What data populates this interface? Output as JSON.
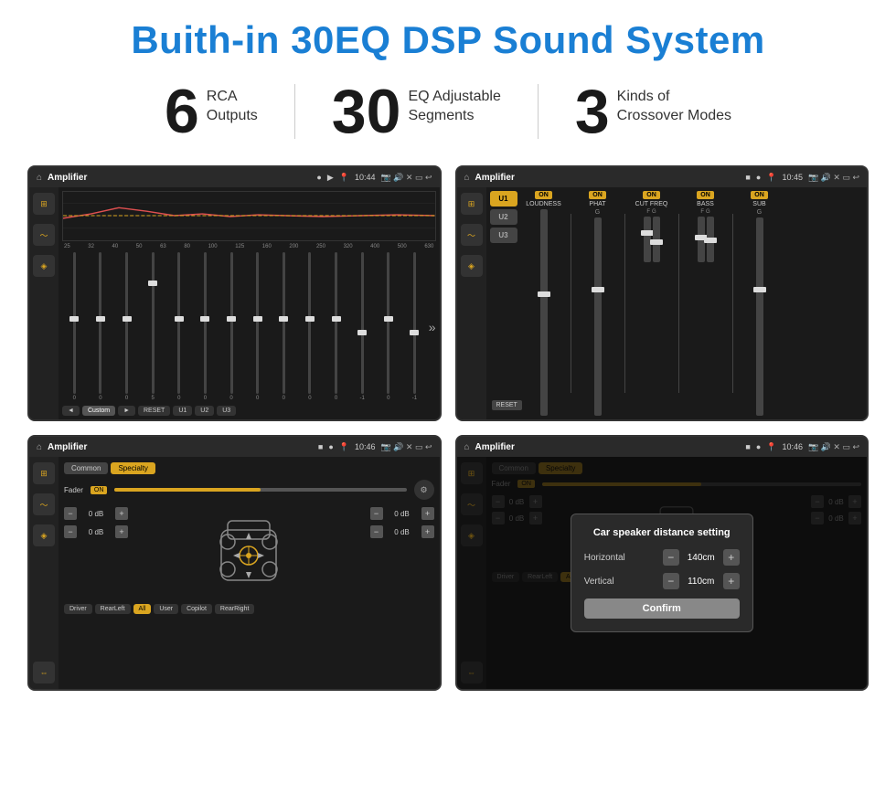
{
  "title": "Buith-in 30EQ DSP Sound System",
  "stats": [
    {
      "number": "6",
      "line1": "RCA",
      "line2": "Outputs"
    },
    {
      "number": "30",
      "line1": "EQ Adjustable",
      "line2": "Segments"
    },
    {
      "number": "3",
      "line1": "Kinds of",
      "line2": "Crossover Modes"
    }
  ],
  "screens": [
    {
      "id": "screen1",
      "topbar": {
        "title": "Amplifier",
        "time": "10:44"
      },
      "type": "eq",
      "freqs": [
        "25",
        "32",
        "40",
        "50",
        "63",
        "80",
        "100",
        "125",
        "160",
        "200",
        "250",
        "320",
        "400",
        "500",
        "630"
      ],
      "values": [
        "0",
        "0",
        "0",
        "5",
        "0",
        "0",
        "0",
        "0",
        "0",
        "0",
        "0",
        "-1",
        "0",
        "-1"
      ],
      "footer": [
        "◄",
        "Custom",
        "►",
        "RESET",
        "U1",
        "U2",
        "U3"
      ]
    },
    {
      "id": "screen2",
      "topbar": {
        "title": "Amplifier",
        "time": "10:45"
      },
      "type": "amplifier",
      "presets": [
        "U1",
        "U2",
        "U3"
      ],
      "sections": [
        {
          "label": "LOUDNESS",
          "on": true
        },
        {
          "label": "PHAT",
          "on": true
        },
        {
          "label": "CUT FREQ",
          "on": true
        },
        {
          "label": "BASS",
          "on": true
        },
        {
          "label": "SUB",
          "on": true
        }
      ],
      "reset": "RESET"
    },
    {
      "id": "screen3",
      "topbar": {
        "title": "Amplifier",
        "time": "10:46"
      },
      "type": "crossover",
      "tabs": [
        "Common",
        "Specialty"
      ],
      "activeTab": 1,
      "fader": {
        "label": "Fader",
        "on": "ON"
      },
      "leftDb": [
        "0 dB",
        "0 dB"
      ],
      "rightDb": [
        "0 dB",
        "0 dB"
      ],
      "footer": [
        "Driver",
        "RearLeft",
        "All",
        "User",
        "Copilot",
        "RearRight"
      ]
    },
    {
      "id": "screen4",
      "topbar": {
        "title": "Amplifier",
        "time": "10:46"
      },
      "type": "crossover-dialog",
      "tabs": [
        "Common",
        "Specialty"
      ],
      "activeTab": 1,
      "dialog": {
        "title": "Car speaker distance setting",
        "fields": [
          {
            "label": "Horizontal",
            "value": "140cm"
          },
          {
            "label": "Vertical",
            "value": "110cm"
          }
        ],
        "confirm": "Confirm",
        "rightDb": [
          "0 dB",
          "0 dB"
        ]
      }
    }
  ]
}
